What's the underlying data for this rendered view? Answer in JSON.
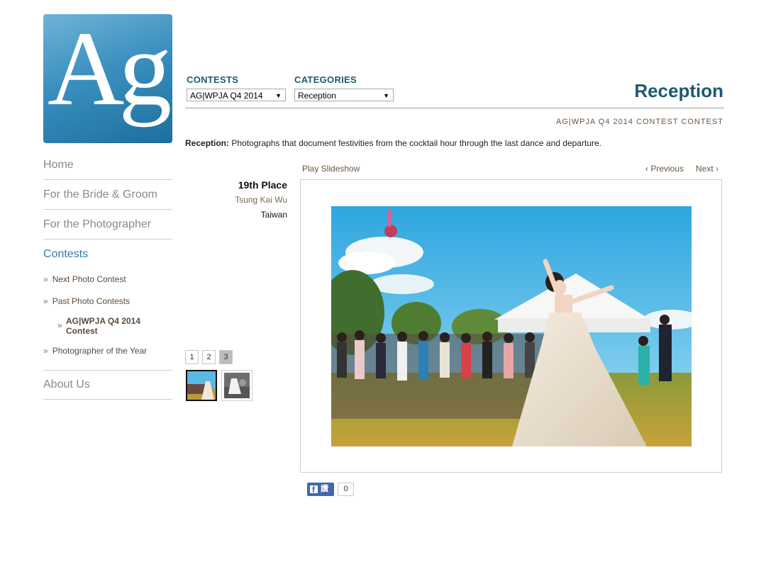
{
  "logo": {
    "text": "Ag"
  },
  "nav": {
    "home": "Home",
    "bride_groom": "For the Bride & Groom",
    "photographer": "For the Photographer",
    "contests": "Contests",
    "sub": {
      "next": "Next Photo Contest",
      "past": "Past Photo Contests",
      "current": "AG|WPJA Q4 2014 Contest",
      "poty": "Photographer of the Year"
    },
    "about": "About Us",
    "chevron": "»"
  },
  "header": {
    "contests_label": "CONTESTS",
    "contests_selected": "AG|WPJA Q4 2014",
    "categories_label": "CATEGORIES",
    "categories_selected": "Reception",
    "title": "Reception",
    "contest_line": "AG|WPJA Q4 2014 CONTEST CONTEST"
  },
  "description": {
    "term": "Reception:",
    "text": " Photographs that document festivities from the cocktail hour through the last dance and departure."
  },
  "entry": {
    "place": "19th Place",
    "photographer": "Tsung Kai Wu",
    "country": "Taiwan"
  },
  "controls": {
    "play": "Play Slideshow",
    "previous": "‹ Previous",
    "next": "Next ›"
  },
  "pager": {
    "pages": [
      "1",
      "2",
      "3"
    ],
    "current": "3"
  },
  "share": {
    "label": "讚",
    "count": "0"
  },
  "colors": {
    "title": "#1d5a70",
    "accent": "#2f7fa8",
    "link": "#6b5540"
  }
}
